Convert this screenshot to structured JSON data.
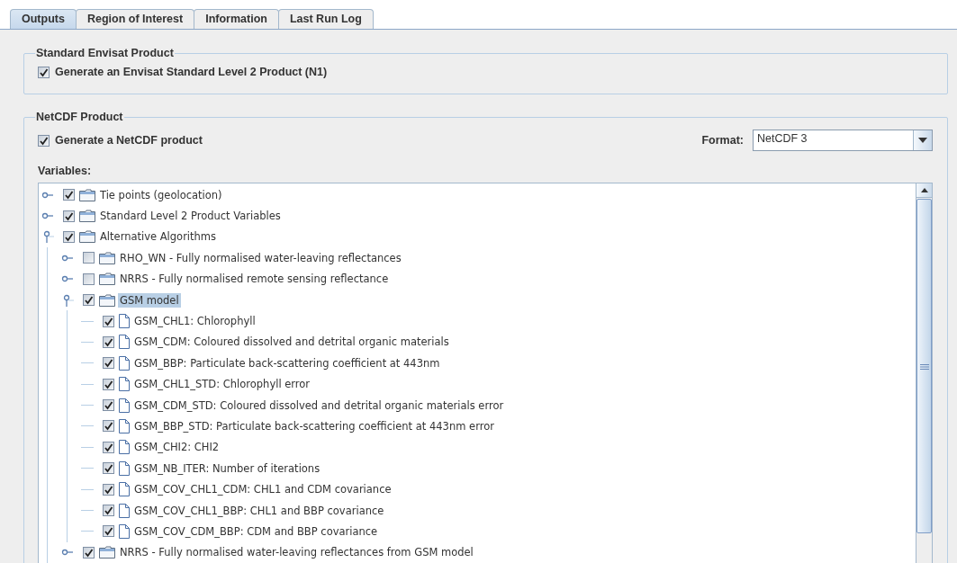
{
  "tabs": [
    {
      "label": "Outputs",
      "selected": true
    },
    {
      "label": "Region of Interest",
      "selected": false
    },
    {
      "label": "Information",
      "selected": false
    },
    {
      "label": "Last Run Log",
      "selected": false
    }
  ],
  "standard_group": {
    "title": "Standard Envisat Product",
    "checkbox": {
      "label": "Generate an Envisat Standard Level 2 Product (N1)",
      "checked": true
    }
  },
  "netcdf_group": {
    "title": "NetCDF Product",
    "checkbox": {
      "label": "Generate a NetCDF product",
      "checked": true
    },
    "format": {
      "label": "Format:",
      "value": "NetCDF 3"
    },
    "variables_label": "Variables:",
    "tree": [
      {
        "label": "Tie points (geolocation)",
        "kind": "folder",
        "checked": true,
        "expanded": false,
        "selected": false
      },
      {
        "label": "Standard Level 2 Product Variables",
        "kind": "folder",
        "checked": true,
        "expanded": false,
        "selected": false
      },
      {
        "label": "Alternative Algorithms",
        "kind": "folder",
        "checked": true,
        "expanded": true,
        "selected": false,
        "children": [
          {
            "label": "RHO_WN - Fully normalised water-leaving reflectances",
            "kind": "folder",
            "checked": false,
            "expanded": false,
            "selected": false
          },
          {
            "label": "NRRS - Fully normalised remote sensing reflectance",
            "kind": "folder",
            "checked": false,
            "expanded": false,
            "selected": false
          },
          {
            "label": "GSM model",
            "kind": "folder",
            "checked": true,
            "expanded": true,
            "selected": true,
            "children": [
              {
                "label": "GSM_CHL1: Chlorophyll",
                "kind": "file",
                "checked": true,
                "selected": false
              },
              {
                "label": "GSM_CDM: Coloured dissolved and detrital organic materials",
                "kind": "file",
                "checked": true,
                "selected": false
              },
              {
                "label": "GSM_BBP: Particulate back-scattering coefficient at 443nm",
                "kind": "file",
                "checked": true,
                "selected": false
              },
              {
                "label": "GSM_CHL1_STD: Chlorophyll error",
                "kind": "file",
                "checked": true,
                "selected": false
              },
              {
                "label": "GSM_CDM_STD: Coloured dissolved and detrital organic materials error",
                "kind": "file",
                "checked": true,
                "selected": false
              },
              {
                "label": "GSM_BBP_STD: Particulate back-scattering coefficient at 443nm error",
                "kind": "file",
                "checked": true,
                "selected": false
              },
              {
                "label": "GSM_CHI2: CHI2",
                "kind": "file",
                "checked": true,
                "selected": false
              },
              {
                "label": "GSM_NB_ITER: Number of iterations",
                "kind": "file",
                "checked": true,
                "selected": false
              },
              {
                "label": "GSM_COV_CHL1_CDM: CHL1 and CDM covariance",
                "kind": "file",
                "checked": true,
                "selected": false
              },
              {
                "label": "GSM_COV_CHL1_BBP: CHL1 and BBP covariance",
                "kind": "file",
                "checked": true,
                "selected": false
              },
              {
                "label": "GSM_COV_CDM_BBP: CDM and BBP covariance",
                "kind": "file",
                "checked": true,
                "selected": false
              }
            ]
          },
          {
            "label": "NRRS - Fully normalised water-leaving reflectances from GSM model",
            "kind": "folder",
            "checked": true,
            "expanded": false,
            "selected": false
          }
        ]
      }
    ]
  }
}
